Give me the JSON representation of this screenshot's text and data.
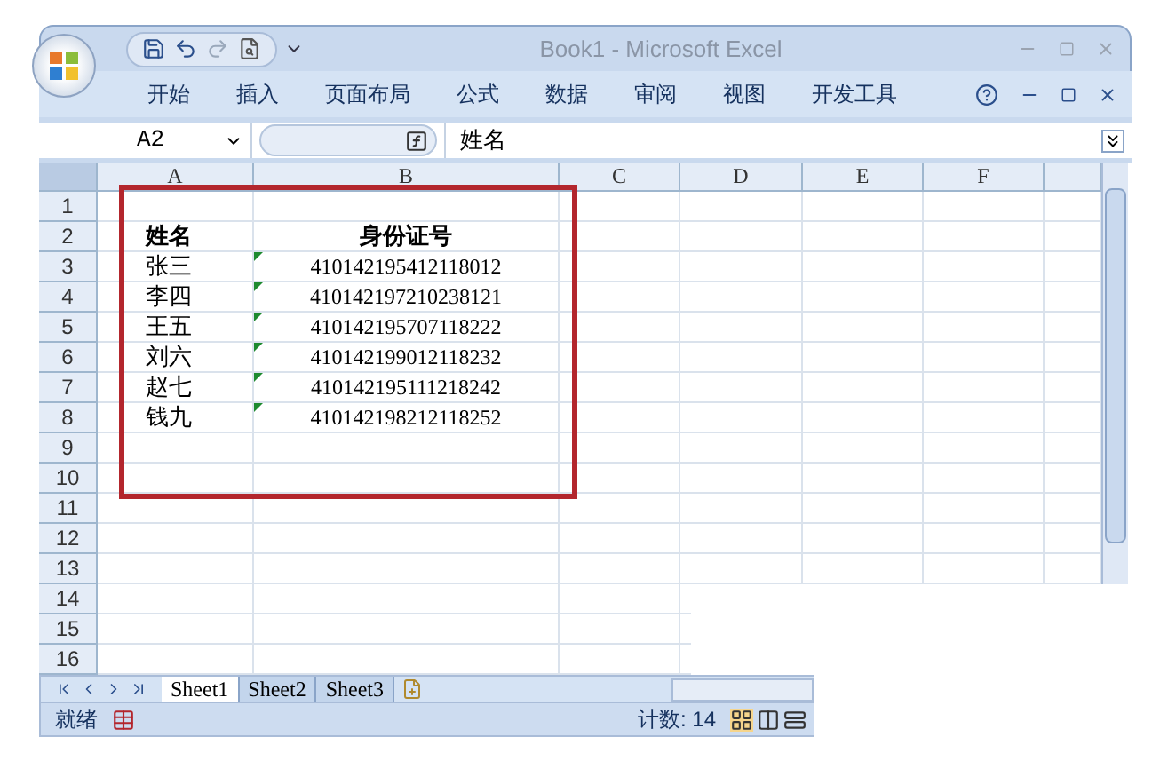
{
  "window": {
    "title": "Book1 - Microsoft Excel"
  },
  "ribbon_tabs": [
    {
      "label": "开始"
    },
    {
      "label": "插入"
    },
    {
      "label": "页面布局"
    },
    {
      "label": "公式"
    },
    {
      "label": "数据"
    },
    {
      "label": "审阅"
    },
    {
      "label": "视图"
    },
    {
      "label": "开发工具"
    }
  ],
  "formula_bar": {
    "name_box": "A2",
    "formula": "姓名"
  },
  "columns": [
    "A",
    "B",
    "C",
    "D",
    "E",
    "F"
  ],
  "rows": [
    {
      "number": "1"
    },
    {
      "number": "2",
      "name": "姓名",
      "id": "身份证号",
      "kind": "header"
    },
    {
      "number": "3",
      "name": "张三",
      "id": "410142195412118012",
      "kind": "data",
      "error_flag": true
    },
    {
      "number": "4",
      "name": "李四",
      "id": "410142197210238121",
      "kind": "data",
      "error_flag": true
    },
    {
      "number": "5",
      "name": "王五",
      "id": "410142195707118222",
      "kind": "data",
      "error_flag": true
    },
    {
      "number": "6",
      "name": "刘六",
      "id": "410142199012118232",
      "kind": "data",
      "error_flag": true
    },
    {
      "number": "7",
      "name": "赵七",
      "id": "410142195111218242",
      "kind": "data",
      "error_flag": true
    },
    {
      "number": "8",
      "name": "钱九",
      "id": "410142198212118252",
      "kind": "data",
      "error_flag": true
    },
    {
      "number": "9"
    },
    {
      "number": "10"
    },
    {
      "number": "11"
    },
    {
      "number": "12"
    },
    {
      "number": "13"
    },
    {
      "number": "14"
    },
    {
      "number": "15"
    },
    {
      "number": "16"
    }
  ],
  "sheet_tabs": [
    {
      "label": "Sheet1",
      "selected": true
    },
    {
      "label": "Sheet2",
      "selected": false
    },
    {
      "label": "Sheet3",
      "selected": false
    }
  ],
  "status_bar": {
    "mode": "就绪",
    "count": "计数: 14"
  }
}
